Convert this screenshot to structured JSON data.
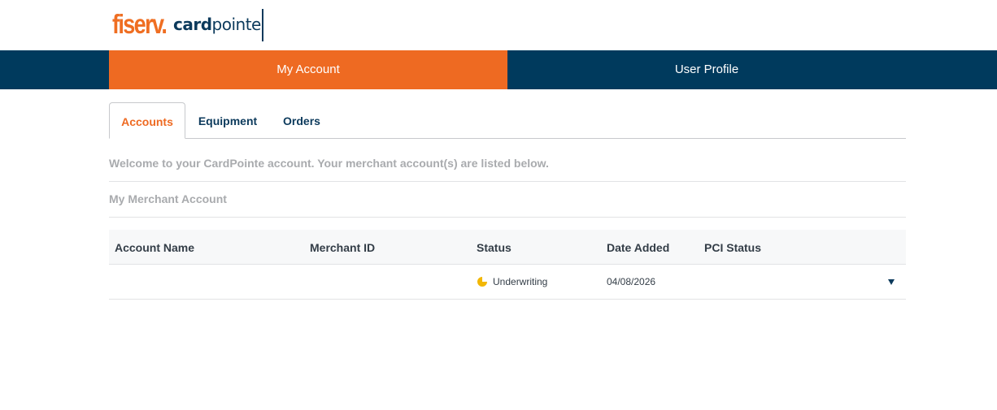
{
  "brand": {
    "primary_logo": "fiserv.",
    "product_logo_bold": "card",
    "product_logo_light": "pointe",
    "accent_color": "#ee6a22",
    "navy_color": "#003a5d"
  },
  "topnav": {
    "tabs": [
      {
        "label": "My Account",
        "active": true
      },
      {
        "label": "User Profile",
        "active": false
      }
    ]
  },
  "subtabs": [
    {
      "label": "Accounts",
      "active": true
    },
    {
      "label": "Equipment",
      "active": false
    },
    {
      "label": "Orders",
      "active": false
    }
  ],
  "welcome_text": "Welcome to your CardPointe account. Your merchant account(s) are listed below.",
  "section_title": "My Merchant Account",
  "table": {
    "columns": [
      "Account Name",
      "Merchant ID",
      "Status",
      "Date Added",
      "PCI Status"
    ],
    "rows": [
      {
        "account_name": "",
        "merchant_id": "",
        "status": "Underwriting",
        "status_icon": "half-moon-icon",
        "status_color": "#f2b705",
        "date_added": "04/08/2026",
        "pci_status": ""
      }
    ]
  },
  "icons": {
    "expand": "caret-down-icon"
  }
}
